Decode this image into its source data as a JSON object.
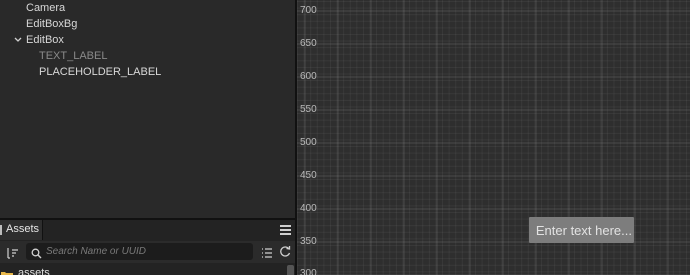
{
  "hierarchy": {
    "nodes": [
      {
        "label": "Camera",
        "expanded": null,
        "dim": false
      },
      {
        "label": "EditBoxBg",
        "expanded": null,
        "dim": false
      },
      {
        "label": "EditBox",
        "expanded": true,
        "dim": false
      },
      {
        "label": "TEXT_LABEL",
        "expanded": null,
        "dim": true
      },
      {
        "label": "PLACEHOLDER_LABEL",
        "expanded": null,
        "dim": false
      }
    ]
  },
  "assets": {
    "tab_label": "Assets",
    "search_placeholder": "Search Name or UUID",
    "root_label": "assets"
  },
  "scene": {
    "ruler_labels": [
      "700",
      "650",
      "600",
      "550",
      "500",
      "450",
      "400",
      "350",
      "300"
    ],
    "editbox_placeholder": "Enter text here..."
  },
  "colors": {
    "panel_bg": "#292929",
    "scene_bg": "#2e2e2e",
    "editbox_bg": "#7d7d7d",
    "folder_icon": "#e8b84a"
  },
  "icons": [
    "chevron-down-icon",
    "assets-tab-icon",
    "menu-icon",
    "sort-icon",
    "search-icon",
    "list-icon",
    "refresh-icon",
    "folder-icon"
  ]
}
